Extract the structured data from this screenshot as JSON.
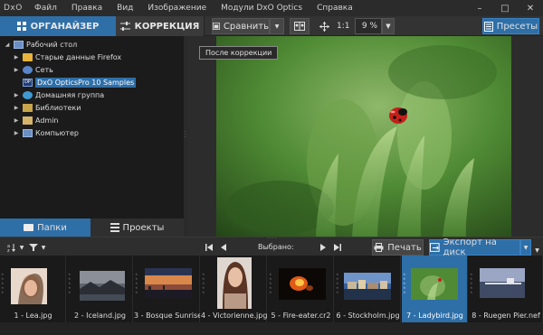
{
  "app": {
    "logo": "DxO",
    "menu": [
      "Файл",
      "Правка",
      "Вид",
      "Изображение",
      "Модули DxO Optics",
      "Справка"
    ],
    "window_controls": [
      "–",
      "□",
      "✕"
    ]
  },
  "toolbar": {
    "tab_organizer": "ОРГАНАЙЗЕР",
    "tab_correction": "КОРРЕКЦИЯ",
    "compare_label": "Сравнить",
    "zoom_one_to_one": "1:1",
    "zoom_value": "9 %",
    "presets_label": "Пресеты"
  },
  "tree": {
    "items": [
      {
        "label": "Рабочий стол",
        "icon": "desktop-icon",
        "expanded": true,
        "selected": false
      },
      {
        "label": "Старые данные Firefox",
        "icon": "folder-icon",
        "expanded": false,
        "selected": false
      },
      {
        "label": "Сеть",
        "icon": "network-icon",
        "expanded": false,
        "selected": false
      },
      {
        "label": "DxO OpticsPro 10 Samples",
        "icon": "dxo-folder-icon",
        "expanded": false,
        "selected": true
      },
      {
        "label": "Домашняя группа",
        "icon": "homegroup-icon",
        "expanded": false,
        "selected": false
      },
      {
        "label": "Библиотеки",
        "icon": "library-icon",
        "expanded": false,
        "selected": false
      },
      {
        "label": "Admin",
        "icon": "user-folder-icon",
        "expanded": false,
        "selected": false
      },
      {
        "label": "Компьютер",
        "icon": "computer-icon",
        "expanded": false,
        "selected": false
      }
    ],
    "tab_folders": "Папки",
    "tab_projects": "Проекты"
  },
  "viewer": {
    "tooltip": "После коррекции"
  },
  "filmbar": {
    "selected_label": "Выбрано:",
    "print_label": "Печать",
    "export_label": "Экспорт на диск"
  },
  "filmstrip": {
    "thumbnails": [
      {
        "name": "1 - Lea.jpg",
        "selected": false
      },
      {
        "name": "2 - Iceland.jpg",
        "selected": false
      },
      {
        "name": "3 - Bosque Sunrise....",
        "selected": false
      },
      {
        "name": "4 - Victorienne.jpg",
        "selected": false
      },
      {
        "name": "5 - Fire-eater.cr2",
        "selected": false
      },
      {
        "name": "6 - Stockholm.jpg",
        "selected": false
      },
      {
        "name": "7 - Ladybird.jpg",
        "selected": true
      },
      {
        "name": "8 - Ruegen Pier.nef",
        "selected": false
      }
    ]
  },
  "colors": {
    "accent": "#2e6fa8",
    "background": "#1e1e1e",
    "toolbar": "#333333"
  }
}
